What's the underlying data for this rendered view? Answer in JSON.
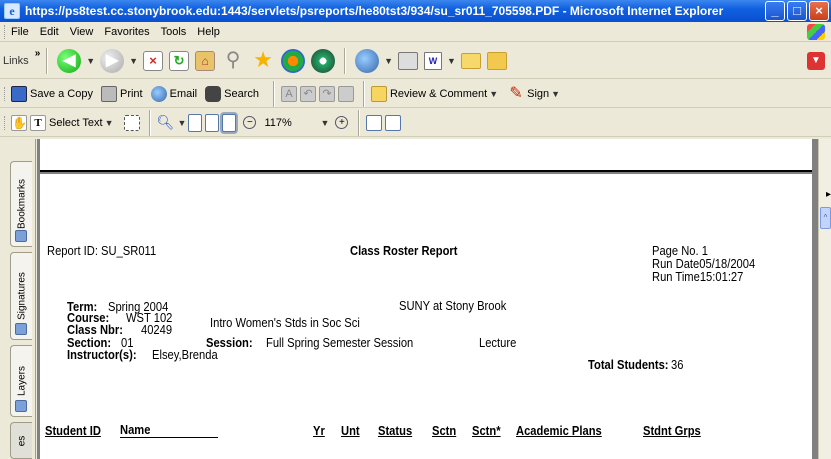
{
  "window": {
    "title": "https://ps8test.cc.stonybrook.edu:1443/servlets/psreports/he80tst3/934/su_sr011_705598.PDF - Microsoft Internet Explorer"
  },
  "menu": [
    "File",
    "Edit",
    "View",
    "Favorites",
    "Tools",
    "Help"
  ],
  "ie_toolbar": {
    "links_label": "Links",
    "chevron": "»",
    "icons": [
      "back-icon",
      "forward-icon",
      "stop-icon",
      "refresh-icon",
      "home-icon",
      "search-icon",
      "favorites-icon",
      "media-icon",
      "history-icon",
      "mail-icon",
      "print-icon",
      "word-icon",
      "folder-icon"
    ]
  },
  "acrobat_toolbar": {
    "save_copy": "Save a Copy",
    "print": "Print",
    "email": "Email",
    "search": "Search",
    "review": "Review & Comment",
    "sign": "Sign",
    "select_text": "Select Text",
    "zoom_value": "117%"
  },
  "side_tabs": [
    "Bookmarks",
    "Signatures",
    "Layers",
    "es"
  ],
  "report": {
    "report_id": "Report ID:  SU_SR011",
    "title": "Class Roster Report",
    "page_no": "Page No. 1",
    "run_date": "Run Date05/18/2004",
    "run_time": "Run Time15:01:27",
    "term_label": "Term:",
    "term_value": "Spring 2004",
    "university": "SUNY at Stony Brook",
    "course_label": "Course:",
    "course_value": "WST 102",
    "course_desc": "Intro Women's Stds in Soc Sci",
    "classnbr_label": "Class Nbr:",
    "classnbr_value": "40249",
    "section_label": "Section:",
    "section_value": "01",
    "session_label": "Session:",
    "session_value": "Full Spring Semester Session",
    "component": "Lecture",
    "instructor_label": "Instructor(s):",
    "instructor_value": "Elsey,Brenda",
    "total_label": "Total Students:",
    "total_value": "36",
    "columns": [
      "Student ID",
      "Name",
      "Yr",
      "Unt",
      "Status",
      "Sctn",
      "Sctn*",
      "Academic Plans",
      "Stdnt Grps"
    ]
  }
}
